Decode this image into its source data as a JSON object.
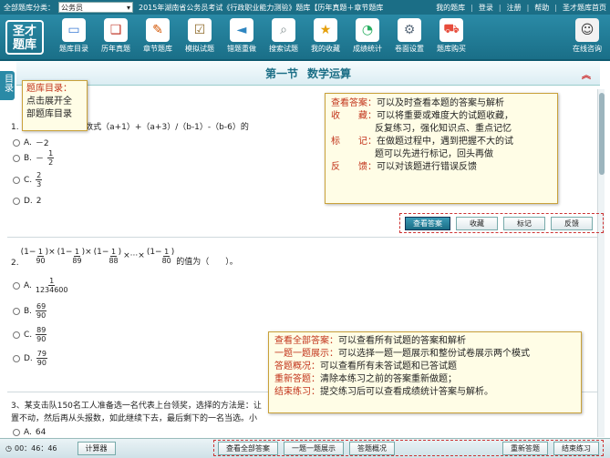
{
  "topbar": {
    "category_label": "全部题库分类：",
    "category_value": "公务员",
    "breadcrumb": "2015年湖南省公务员考试《行政职业能力测验》题库【历年真题＋章节题库",
    "links": [
      "我的题库",
      "登录",
      "注册",
      "帮助",
      "圣才题库首页"
    ]
  },
  "logo": {
    "line1": "圣才",
    "line2": "题库"
  },
  "toolbar": {
    "items": [
      {
        "label": "题库目录",
        "icon": "monitor-icon",
        "color": "#3a7bd5"
      },
      {
        "label": "历年真题",
        "icon": "book-icon",
        "color": "#c0392b"
      },
      {
        "label": "章节题库",
        "icon": "notebook-pen-icon",
        "color": "#d35400"
      },
      {
        "label": "模拟试题",
        "icon": "checklist-icon",
        "color": "#8e6a2a"
      },
      {
        "label": "错题重做",
        "icon": "back-arrow-icon",
        "color": "#2e86c1"
      },
      {
        "label": "搜索试题",
        "icon": "search-icon",
        "color": "#7f8c8d"
      },
      {
        "label": "我的收藏",
        "icon": "star-bookmark-icon",
        "color": "#e5a00d"
      },
      {
        "label": "成绩统计",
        "icon": "pie-chart-icon",
        "color": "#27ae60"
      },
      {
        "label": "卷面设置",
        "icon": "gear-icon",
        "color": "#5d6d7e"
      },
      {
        "label": "题库购买",
        "icon": "cart-icon",
        "color": "#e74c3c"
      }
    ],
    "consult": "在线咨询"
  },
  "sidetab": {
    "label": "目录"
  },
  "title": {
    "section": "第一节",
    "name": "数学运算"
  },
  "q1": {
    "text": "1.                        +b)⁴=0，那么代数式（a+1）+（a+3）/（b-1）-（b-6）的",
    "options": [
      {
        "letter": "A.",
        "value": "－2"
      },
      {
        "letter": "B.",
        "value": "－",
        "num": "1",
        "den": "2"
      },
      {
        "letter": "C.",
        "value": "",
        "num": "2",
        "den": "3"
      },
      {
        "letter": "D.",
        "value": "2"
      }
    ]
  },
  "buttons": {
    "view_answer": "查看答案",
    "favorite": "收藏",
    "mark": "标记",
    "feedback": "反馈"
  },
  "q2": {
    "number": "2.",
    "fractions": [
      "90",
      "89",
      "88",
      "80"
    ],
    "one": "1",
    "ellipsis": "×···×",
    "suffix": "的值为（　　）。",
    "options": [
      {
        "letter": "A.",
        "num": "1",
        "den": "1234600"
      },
      {
        "letter": "B.",
        "num": "69",
        "den": "90"
      },
      {
        "letter": "C.",
        "num": "89",
        "den": "90"
      },
      {
        "letter": "D.",
        "num": "79",
        "den": "90"
      }
    ]
  },
  "q3": {
    "line1": "3、某支击队150名工人准备选一名代表上台领奖，选择的方法是：让",
    "line2": "置不动，然后再从头报数，如此继续下去，最后剩下的一名当选。小",
    "optA": {
      "letter": "A.",
      "value": "64"
    }
  },
  "callout_dir": {
    "title": "题库目录：",
    "line2": "点击展开全",
    "line3": "部题库目录"
  },
  "callout_answer": {
    "rows": [
      {
        "k": "查看答案：",
        "v": "可以及时查看本题的答案与解析"
      },
      {
        "k": "收　　藏：",
        "v": "可以将重要或难度大的试题收藏，"
      },
      {
        "k": "",
        "v": "反复练习，强化知识点、重点记忆"
      },
      {
        "k": "标　　记：",
        "v": "在做题过程中，遇到把握不大的试"
      },
      {
        "k": "",
        "v": "题可以先进行标记，回头再做"
      },
      {
        "k": "反　　馈：",
        "v": "可以对该题进行错误反馈"
      }
    ]
  },
  "callout_bottom": {
    "rows": [
      {
        "k": "查看全部答案：",
        "v": "可以查看所有试题的答案和解析"
      },
      {
        "k": "一题一题展示：",
        "v": "可以选择一题一题展示和整份试卷展示两个模式"
      },
      {
        "k": "答题概况：",
        "v": "可以查看所有未答试题和已答试题"
      },
      {
        "k": "重新答题：",
        "v": "清除本练习之前的答案重新做题；"
      },
      {
        "k": "结束练习：",
        "v": "提交练习后可以查看成绩统计答案与解析。"
      }
    ]
  },
  "bottombar": {
    "timer": "00：46：46",
    "calculator": "计算器",
    "view_all": "查看全部答案",
    "one_by_one": "一题一题展示",
    "overview": "答题概况",
    "redo": "重新答题",
    "finish": "结束练习"
  }
}
